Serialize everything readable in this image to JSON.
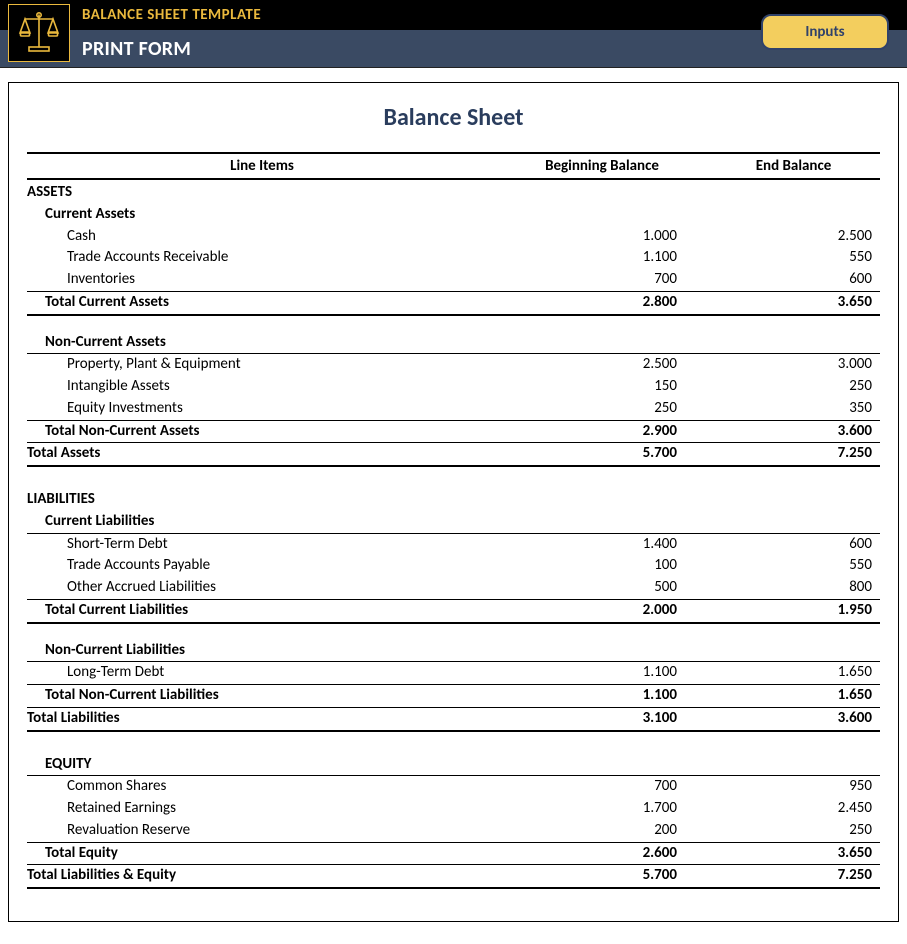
{
  "header": {
    "line1": "BALANCE SHEET TEMPLATE",
    "line2": "PRINT FORM",
    "button": "Inputs"
  },
  "sheet": {
    "title": "Balance Sheet",
    "columns": {
      "label": "Line Items",
      "beg": "Beginning Balance",
      "end": "End Balance"
    },
    "assets": {
      "heading": "ASSETS",
      "current": {
        "heading": "Current Assets",
        "items": [
          {
            "label": "Cash",
            "beg": "1.000",
            "end": "2.500"
          },
          {
            "label": "Trade Accounts Receivable",
            "beg": "1.100",
            "end": "550"
          },
          {
            "label": "Inventories",
            "beg": "700",
            "end": "600"
          }
        ],
        "total": {
          "label": "Total Current Assets",
          "beg": "2.800",
          "end": "3.650"
        }
      },
      "noncurrent": {
        "heading": "Non-Current Assets",
        "items": [
          {
            "label": "Property, Plant & Equipment",
            "beg": "2.500",
            "end": "3.000"
          },
          {
            "label": "Intangible Assets",
            "beg": "150",
            "end": "250"
          },
          {
            "label": "Equity Investments",
            "beg": "250",
            "end": "350"
          }
        ],
        "total": {
          "label": "Total Non-Current Assets",
          "beg": "2.900",
          "end": "3.600"
        }
      },
      "grand": {
        "label": "Total Assets",
        "beg": "5.700",
        "end": "7.250"
      }
    },
    "liabilities": {
      "heading": "LIABILITIES",
      "current": {
        "heading": "Current Liabilities",
        "items": [
          {
            "label": "Short-Term Debt",
            "beg": "1.400",
            "end": "600"
          },
          {
            "label": "Trade Accounts Payable",
            "beg": "100",
            "end": "550"
          },
          {
            "label": "Other Accrued Liabilities",
            "beg": "500",
            "end": "800"
          }
        ],
        "total": {
          "label": "Total Current Liabilities",
          "beg": "2.000",
          "end": "1.950"
        }
      },
      "noncurrent": {
        "heading": "Non-Current Liabilities",
        "items": [
          {
            "label": "Long-Term Debt",
            "beg": "1.100",
            "end": "1.650"
          }
        ],
        "total": {
          "label": "Total Non-Current Liabilities",
          "beg": "1.100",
          "end": "1.650"
        }
      },
      "grand": {
        "label": "Total Liabilities",
        "beg": "3.100",
        "end": "3.600"
      }
    },
    "equity": {
      "heading": "EQUITY",
      "items": [
        {
          "label": "Common Shares",
          "beg": "700",
          "end": "950"
        },
        {
          "label": "Retained Earnings",
          "beg": "1.700",
          "end": "2.450"
        },
        {
          "label": "Revaluation Reserve",
          "beg": "200",
          "end": "250"
        }
      ],
      "total": {
        "label": "Total Equity",
        "beg": "2.600",
        "end": "3.650"
      }
    },
    "grand": {
      "label": "Total Liabilities & Equity",
      "beg": "5.700",
      "end": "7.250"
    }
  }
}
